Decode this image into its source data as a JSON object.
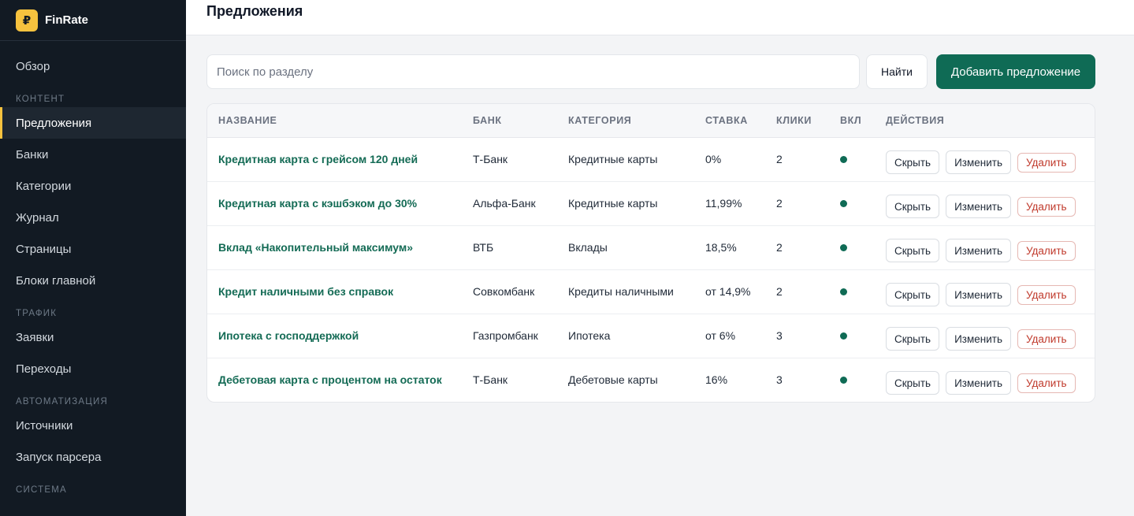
{
  "app": {
    "logo_symbol": "₽",
    "name": "FinRate"
  },
  "sidebar": {
    "items": [
      {
        "label": "Обзор",
        "type": "item"
      },
      {
        "label": "КОНТЕНТ",
        "type": "section"
      },
      {
        "label": "Предложения",
        "type": "item",
        "active": true
      },
      {
        "label": "Банки",
        "type": "item"
      },
      {
        "label": "Категории",
        "type": "item"
      },
      {
        "label": "Журнал",
        "type": "item"
      },
      {
        "label": "Страницы",
        "type": "item"
      },
      {
        "label": "Блоки главной",
        "type": "item"
      },
      {
        "label": "ТРАФИК",
        "type": "section"
      },
      {
        "label": "Заявки",
        "type": "item"
      },
      {
        "label": "Переходы",
        "type": "item"
      },
      {
        "label": "АВТОМАТИЗАЦИЯ",
        "type": "section"
      },
      {
        "label": "Источники",
        "type": "item"
      },
      {
        "label": "Запуск парсера",
        "type": "item"
      },
      {
        "label": "СИСТЕМА",
        "type": "section"
      }
    ]
  },
  "header": {
    "title": "Предложения"
  },
  "toolbar": {
    "search_placeholder": "Поиск по разделу",
    "search_value": "",
    "find_label": "Найти",
    "add_label": "Добавить предложение"
  },
  "table": {
    "columns": [
      "НАЗВАНИЕ",
      "БАНК",
      "КАТЕГОРИЯ",
      "СТАВКА",
      "КЛИКИ",
      "ВКЛ",
      "ДЕЙСТВИЯ"
    ],
    "actions": {
      "hide": "Скрыть",
      "edit": "Изменить",
      "delete": "Удалить"
    },
    "rows": [
      {
        "name": "Кредитная карта с грейсом 120 дней",
        "bank": "Т-Банк",
        "category": "Кредитные карты",
        "rate": "0%",
        "clicks": "2",
        "enabled": true
      },
      {
        "name": "Кредитная карта с кэшбэком до 30%",
        "bank": "Альфа-Банк",
        "category": "Кредитные карты",
        "rate": "11,99%",
        "clicks": "2",
        "enabled": true
      },
      {
        "name": "Вклад «Накопительный максимум»",
        "bank": "ВТБ",
        "category": "Вклады",
        "rate": "18,5%",
        "clicks": "2",
        "enabled": true
      },
      {
        "name": "Кредит наличными без справок",
        "bank": "Совкомбанк",
        "category": "Кредиты наличными",
        "rate": "от 14,9%",
        "clicks": "2",
        "enabled": true
      },
      {
        "name": "Ипотека с господдержкой",
        "bank": "Газпромбанк",
        "category": "Ипотека",
        "rate": "от 6%",
        "clicks": "3",
        "enabled": true
      },
      {
        "name": "Дебетовая карта с процентом на остаток",
        "bank": "Т-Банк",
        "category": "Дебетовые карты",
        "rate": "16%",
        "clicks": "3",
        "enabled": true
      }
    ]
  },
  "colors": {
    "accent": "#0f6b55",
    "brand": "#f6c23e",
    "sidebar_bg": "#121a23",
    "danger": "#c0392b"
  }
}
